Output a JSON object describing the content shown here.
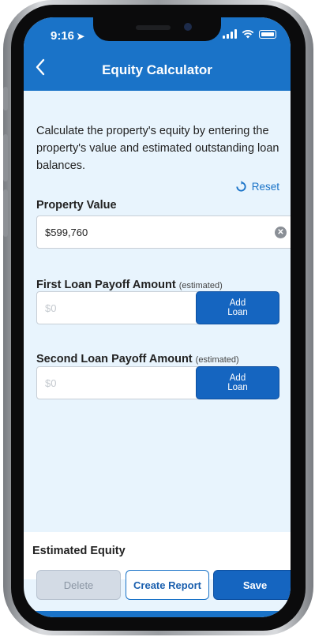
{
  "status_bar": {
    "time": "9:16"
  },
  "nav": {
    "title": "Equity Calculator",
    "back_icon": "chevron-left-icon"
  },
  "intro": "Calculate the property's equity by entering the property's value and estimated outstanding loan balances.",
  "reset": {
    "label": "Reset",
    "icon": "refresh-icon"
  },
  "property_value": {
    "label": "Property Value",
    "value": "$599,760",
    "clear_icon": "clear-circle-icon"
  },
  "first_loan": {
    "label": "First Loan Payoff Amount",
    "hint": "(estimated)",
    "placeholder": "$0",
    "button": "Add\nLoan"
  },
  "second_loan": {
    "label": "Second Loan Payoff Amount",
    "hint": "(estimated)",
    "placeholder": "$0",
    "button": "Add\nLoan"
  },
  "estimated_equity": {
    "label": "Estimated Equity"
  },
  "actions": {
    "delete": "Delete",
    "create_report": "Create Report",
    "save": "Save"
  },
  "colors": {
    "primary": "#1a73c8",
    "background": "#e8f4fd",
    "button_blue": "#1565c0"
  }
}
